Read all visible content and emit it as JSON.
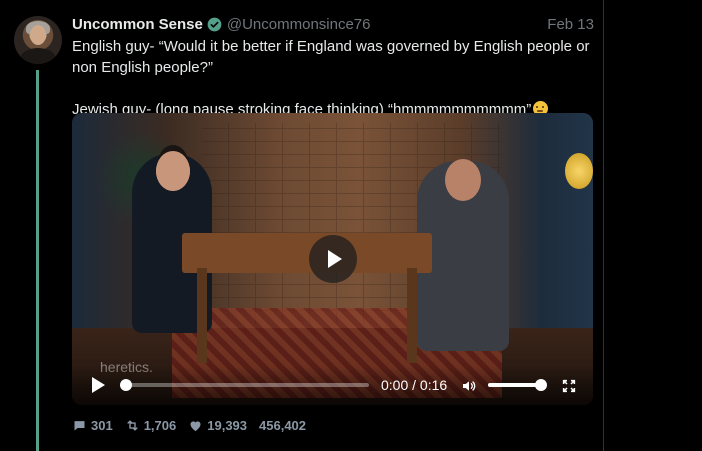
{
  "tweet": {
    "author_name": "Uncommon Sense",
    "handle": "@Uncommonsince76",
    "date": "Feb 13",
    "verified": true,
    "text": "English guy- “Would it be better if England was governed by English people or non English people?”\n\nJewish guy- (long pause stroking face thinking) “hmmmmmmmmmm”",
    "emoji": "thinking-face"
  },
  "video": {
    "watermark": "heretics.",
    "current_time": "0:00",
    "duration": "0:16",
    "progress": 0.0,
    "volume": 0.95
  },
  "actions": {
    "replies": "301",
    "retweets": "1,706",
    "likes": "19,393",
    "views": "456,402"
  },
  "colors": {
    "thread_line": "#55a08a",
    "verified_badge": "#55a08a",
    "muted_text": "#71767b"
  }
}
